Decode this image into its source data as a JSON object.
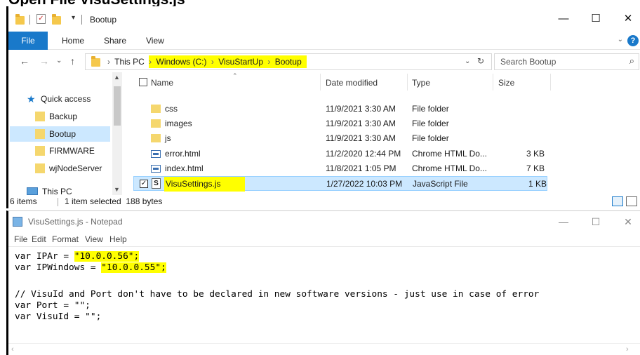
{
  "heading": "Open File VisuSettings.js",
  "explorer": {
    "title": "Bootup",
    "ribbon_tabs": {
      "file": "File",
      "home": "Home",
      "share": "Share",
      "view": "View"
    },
    "window_buttons": {
      "minimize": "—",
      "maximize": "☐",
      "close": "✕"
    },
    "address": {
      "this_pc": "This PC",
      "drive": "Windows (C:)",
      "folder1": "VisuStartUp",
      "folder2": "Bootup"
    },
    "search_placeholder": "Search Bootup",
    "nav": {
      "quick_access": "Quick access",
      "items": [
        "Backup",
        "Bootup",
        "FIRMWARE",
        "wjNodeServer"
      ],
      "this_pc": "This PC"
    },
    "columns": {
      "name": "Name",
      "date": "Date modified",
      "type": "Type",
      "size": "Size"
    },
    "files": [
      {
        "name": "css",
        "date": "11/9/2021 3:30 AM",
        "type": "File folder",
        "size": "",
        "icon": "folder-icon"
      },
      {
        "name": "images",
        "date": "11/9/2021 3:30 AM",
        "type": "File folder",
        "size": "",
        "icon": "folder-icon"
      },
      {
        "name": "js",
        "date": "11/9/2021 3:30 AM",
        "type": "File folder",
        "size": "",
        "icon": "folder-icon"
      },
      {
        "name": "error.html",
        "date": "11/2/2020 12:44 PM",
        "type": "Chrome HTML Do...",
        "size": "3 KB",
        "icon": "html-file-icon"
      },
      {
        "name": "index.html",
        "date": "11/8/2021 1:05 PM",
        "type": "Chrome HTML Do...",
        "size": "7 KB",
        "icon": "html-file-icon"
      },
      {
        "name": "VisuSettings.js",
        "date": "1/27/2022 10:03 PM",
        "type": "JavaScript File",
        "size": "1 KB",
        "icon": "js-file-icon"
      }
    ],
    "status": {
      "count": "6 items",
      "selected": "1 item selected  188 bytes"
    }
  },
  "notepad": {
    "title": "VisuSettings.js - Notepad",
    "menu": {
      "file": "File",
      "edit": "Edit",
      "format": "Format",
      "view": "View",
      "help": "Help"
    },
    "lines": {
      "l1_pre": "var IPAr = ",
      "l1_val": "\"10.0.0.56\";",
      "l2_pre": "var IPWindows = ",
      "l2_val": "\"10.0.0.55\";",
      "l3": "",
      "l4": "// VisuId and Port don't have to be declared in new software versions - just use in case of error",
      "l5": "var Port = \"\";",
      "l6": "var VisuId = \"\";"
    }
  },
  "colors": {
    "accent": "#1979ca",
    "highlight": "#ffff00",
    "selection": "#cce8ff"
  }
}
